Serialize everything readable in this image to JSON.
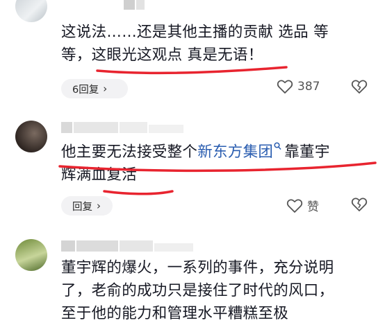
{
  "comments": [
    {
      "text_parts": [
        "这说法……还是其他主播的贡献 选品 等",
        "等，这眼光这观点 真是无语！"
      ],
      "reply_label": "6回复",
      "like_count": "387"
    },
    {
      "text_parts": [
        "他主要无法接受整个",
        "新东方集团",
        "靠董宇",
        "辉满血复活"
      ],
      "reply_label": "回复",
      "like_label": "赞"
    },
    {
      "text_parts": [
        "董宇辉的爆火，一系列的事件，充分说明",
        "了，老俞的成功只是接住了时代的风口，",
        "至于他的能力和管理水平糟糕至极"
      ]
    }
  ],
  "icons": {
    "like": "heart-outline-icon",
    "dislike": "broken-heart-icon",
    "chevron": "chevron-right-icon",
    "search": "search-icon"
  },
  "colors": {
    "link": "#2a5db0",
    "underline": "#e8242f"
  }
}
